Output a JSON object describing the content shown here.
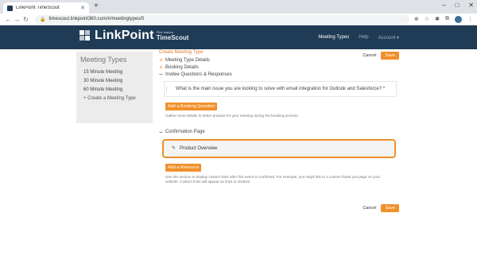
{
  "browser": {
    "tab_title": "LinkPoint TimeScout",
    "new_tab_glyph": "+",
    "url": "timescout.linkpoint360.com/#/meetingtypes/0"
  },
  "header": {
    "logo_main": "LinkPoint",
    "logo_tag": "Pilot feature",
    "logo_product": "TimeScout",
    "nav": [
      {
        "label": "Meeting Types"
      },
      {
        "label": "Help"
      },
      {
        "label": "Account ▾"
      }
    ]
  },
  "sidebar": {
    "title": "Meeting Types",
    "items": [
      {
        "label": "15 Minute Meeting"
      },
      {
        "label": "30 Minute Meeting"
      },
      {
        "label": "60 Minute Meeting"
      },
      {
        "label": "+ Create a Meeting Type"
      }
    ]
  },
  "main": {
    "breadcrumb": "Create Meeting Type",
    "cancel_label": "Cancel",
    "save_label": "Save",
    "sections": {
      "details": "Meeting Type Details",
      "booking": "Booking Details",
      "invitee": "Invitee Questions & Responses",
      "confirmation": "Confirmation Page"
    },
    "question": "What is the main issue you are looking to solve with email integration for Outlook and Salesforce? *",
    "add_question_label": "Add a Booking Question",
    "add_question_help": "Gather more details to better prepare for your meeting during the booking process.",
    "resource_item": "Product Overview",
    "add_resource_label": "Add a Resource",
    "add_resource_help_1": "Use this section to display custom links after this event is confirmed. For example, you might link to a custom thank you page on your",
    "add_resource_help_2": "website. Custom links will appear as links to invitees."
  },
  "colors": {
    "header_bg": "#1f3b55",
    "accent": "#f0902a",
    "sidebar_bg": "#ececec"
  }
}
